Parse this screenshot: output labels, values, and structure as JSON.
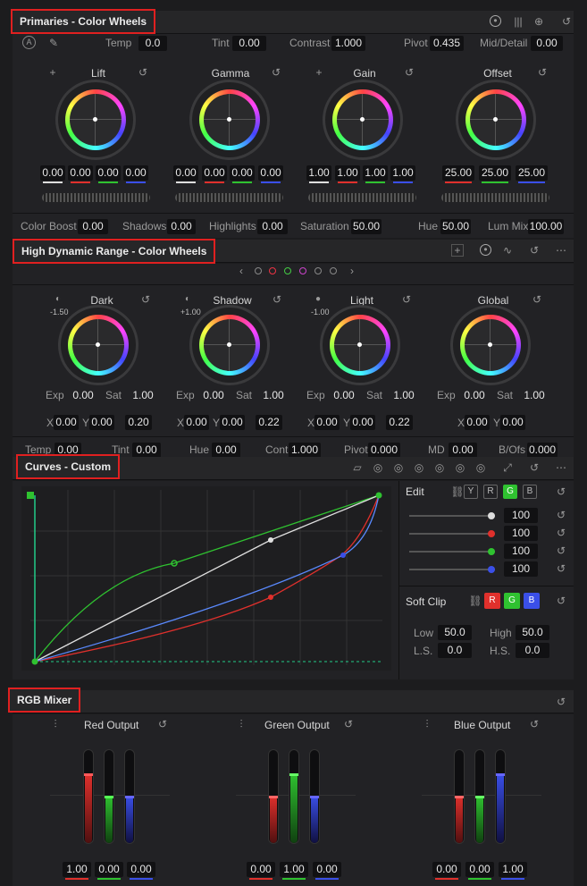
{
  "primaries": {
    "title": "Primaries - Color Wheels",
    "top": {
      "auto": "A",
      "temp_label": "Temp",
      "temp": "0.0",
      "tint_label": "Tint",
      "tint": "0.00",
      "contrast_label": "Contrast",
      "contrast": "1.000",
      "pivot_label": "Pivot",
      "pivot": "0.435",
      "md_label": "Mid/Detail",
      "md": "0.00"
    },
    "wheels": [
      {
        "name": "Lift",
        "values": [
          "0.00",
          "0.00",
          "0.00",
          "0.00"
        ]
      },
      {
        "name": "Gamma",
        "values": [
          "0.00",
          "0.00",
          "0.00",
          "0.00"
        ]
      },
      {
        "name": "Gain",
        "values": [
          "1.00",
          "1.00",
          "1.00",
          "1.00"
        ]
      },
      {
        "name": "Offset",
        "values": [
          "25.00",
          "25.00",
          "25.00"
        ]
      }
    ],
    "bottom": {
      "cb_label": "Color Boost",
      "cb": "0.00",
      "sh_label": "Shadows",
      "sh": "0.00",
      "hl_label": "Highlights",
      "hl": "0.00",
      "sat_label": "Saturation",
      "sat": "50.00",
      "hue_label": "Hue",
      "hue": "50.00",
      "lm_label": "Lum Mix",
      "lm": "100.00"
    }
  },
  "hdr": {
    "title": "High Dynamic Range - Color Wheels",
    "wheels": [
      {
        "name": "Dark",
        "zone": "-1.50",
        "exp": "0.00",
        "sat": "1.00",
        "x": "0.00",
        "y": "0.00",
        "f": "0.20"
      },
      {
        "name": "Shadow",
        "zone": "+1.00",
        "exp": "0.00",
        "sat": "1.00",
        "x": "0.00",
        "y": "0.00",
        "f": "0.22"
      },
      {
        "name": "Light",
        "zone": "-1.00",
        "exp": "0.00",
        "sat": "1.00",
        "x": "0.00",
        "y": "0.00",
        "f": "0.22"
      },
      {
        "name": "Global",
        "exp": "0.00",
        "sat": "1.00",
        "x": "0.00",
        "y": "0.00"
      }
    ],
    "labels": {
      "exp": "Exp",
      "sat": "Sat",
      "x": "X",
      "y": "Y"
    },
    "bottom": {
      "temp_label": "Temp",
      "temp": "0.00",
      "tint_label": "Tint",
      "tint": "0.00",
      "hue_label": "Hue",
      "hue": "0.00",
      "cont_label": "Cont",
      "cont": "1.000",
      "pivot_label": "Pivot",
      "pivot": "0.000",
      "md_label": "MD",
      "md": "0.00",
      "bofs_label": "B/Ofs",
      "bofs": "0.000"
    }
  },
  "curves": {
    "title": "Curves - Custom",
    "edit_label": "Edit",
    "channels": [
      "Y",
      "R",
      "G",
      "B"
    ],
    "intensity": [
      "100",
      "100",
      "100",
      "100"
    ],
    "soft_clip_label": "Soft Clip",
    "clip_channels": [
      "R",
      "G",
      "B"
    ],
    "low_label": "Low",
    "low": "50.0",
    "high_label": "High",
    "high": "50.0",
    "ls_label": "L.S.",
    "ls": "0.0",
    "hs_label": "H.S.",
    "hs": "0.0"
  },
  "mixer": {
    "title": "RGB Mixer",
    "outputs": [
      {
        "name": "Red Output",
        "values": [
          "1.00",
          "0.00",
          "0.00"
        ]
      },
      {
        "name": "Green Output",
        "values": [
          "0.00",
          "1.00",
          "0.00"
        ]
      },
      {
        "name": "Blue Output",
        "values": [
          "0.00",
          "0.00",
          "1.00"
        ]
      }
    ]
  },
  "colors": {
    "red": "#e0302c",
    "green": "#2fc230",
    "blue": "#3a4fe8",
    "highlight": "#e02020"
  }
}
